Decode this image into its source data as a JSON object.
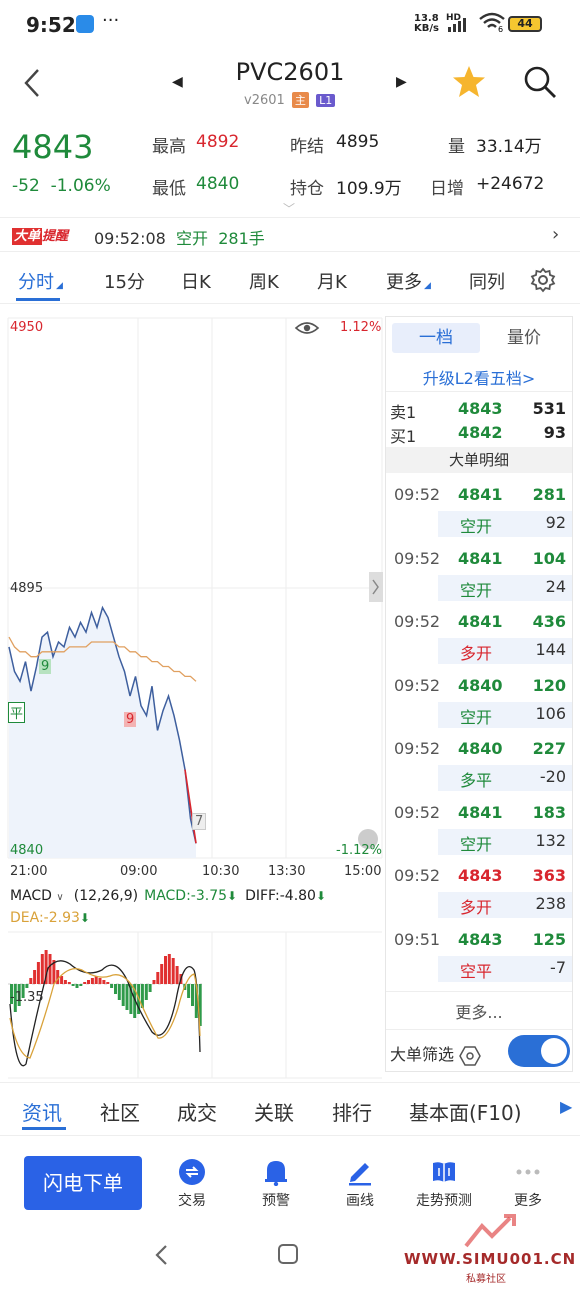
{
  "status": {
    "time": "9:52",
    "dots": "···",
    "net_top": "13.8",
    "net_bottom": "KB/s",
    "hd": "HD",
    "wifi_sub": "6",
    "battery": "44"
  },
  "title": {
    "symbol": "PVC2601",
    "contract": "v2601",
    "tag_main": "主",
    "tag_l1": "L1"
  },
  "quote": {
    "price": "4843",
    "change": "-52",
    "change_pct": "-1.06%",
    "high_label": "最高",
    "high": "4892",
    "low_label": "最低",
    "low": "4840",
    "prev_settle_label": "昨结",
    "prev_settle": "4895",
    "open_int_label": "持仓",
    "open_int": "109.9万",
    "volume_label": "量",
    "volume": "33.14万",
    "daily_inc_label": "日增",
    "daily_inc": "+24672"
  },
  "alert": {
    "badge1": "大单",
    "badge2": "提醒",
    "time": "09:52:08",
    "type": "空开",
    "qty": "281手"
  },
  "tabs": [
    "分时",
    "15分",
    "日K",
    "周K",
    "月K",
    "更多",
    "同列"
  ],
  "chart": {
    "y_top": "4950",
    "y_top_pct": "1.12%",
    "y_mid": "4895",
    "y_bot": "4840",
    "y_bot_pct": "-1.12%",
    "x_labels": [
      "21:00",
      "09:00",
      "10:30",
      "13:30",
      "15:00"
    ],
    "marker_flat": "平",
    "marker_9a": "9",
    "marker_9b": "9",
    "marker_7": "7",
    "macd_name": "MACD",
    "macd_params": "(12,26,9)",
    "macd_val": "MACD:-3.75",
    "diff_val": "DIFF:-4.80",
    "dea_val": "DEA:-2.93",
    "macd_axis": "-1.35"
  },
  "chart_data": {
    "type": "line",
    "series": [
      {
        "values": [
          4883,
          4878,
          4876,
          4880,
          4874,
          4879,
          4885,
          4886,
          4881,
          4884,
          4883,
          4887,
          4885,
          4888,
          4886,
          4890,
          4887,
          4891,
          4889,
          4885,
          4881,
          4878,
          4873,
          4877,
          4871,
          4869,
          4875,
          4866,
          4870,
          4873,
          4869,
          4864,
          4858,
          4848,
          4843
        ]
      },
      {
        "values": [
          4885,
          4883,
          4882,
          4882,
          4881,
          4881,
          4882,
          4882,
          4882,
          4882,
          4882,
          4883,
          4883,
          4883,
          4883,
          4884,
          4884,
          4884,
          4884,
          4884,
          4883,
          4883,
          4882,
          4882,
          4881,
          4881,
          4880,
          4880,
          4879,
          4879,
          4878,
          4878,
          4877,
          4877,
          4876
        ]
      }
    ],
    "ylim": [
      4840,
      4950
    ]
  },
  "book": {
    "seg1": "一档",
    "seg2": "量价",
    "l2": "升级L2看五档>",
    "ask_label": "卖1",
    "ask_price": "4843",
    "ask_vol": "531",
    "bid_label": "买1",
    "bid_price": "4842",
    "bid_vol": "93",
    "detail": "大单明细",
    "trades": [
      {
        "time": "09:52",
        "price": "4841",
        "vol": "281",
        "type": "空开",
        "oi": "92",
        "pc": "green",
        "tc": "green"
      },
      {
        "time": "09:52",
        "price": "4841",
        "vol": "104",
        "type": "空开",
        "oi": "24",
        "pc": "green",
        "tc": "green"
      },
      {
        "time": "09:52",
        "price": "4841",
        "vol": "436",
        "type": "多开",
        "oi": "144",
        "pc": "green",
        "tc": "red"
      },
      {
        "time": "09:52",
        "price": "4840",
        "vol": "120",
        "type": "空开",
        "oi": "106",
        "pc": "green",
        "tc": "green"
      },
      {
        "time": "09:52",
        "price": "4840",
        "vol": "227",
        "type": "多平",
        "oi": "-20",
        "pc": "green",
        "tc": "green"
      },
      {
        "time": "09:52",
        "price": "4841",
        "vol": "183",
        "type": "空开",
        "oi": "132",
        "pc": "green",
        "tc": "green"
      },
      {
        "time": "09:52",
        "price": "4843",
        "vol": "363",
        "type": "多开",
        "oi": "238",
        "pc": "red",
        "tc": "red"
      },
      {
        "time": "09:51",
        "price": "4843",
        "vol": "125",
        "type": "空平",
        "oi": "-7",
        "pc": "green",
        "tc": "red"
      }
    ],
    "more": "更多...",
    "filter": "大单筛选"
  },
  "info_tabs": [
    "资讯",
    "社区",
    "成交",
    "关联",
    "排行",
    "基本面(F10)"
  ],
  "toolbar": {
    "flash": "闪电下单",
    "items": [
      "交易",
      "预警",
      "画线",
      "走势预测",
      "更多"
    ]
  },
  "watermark": {
    "site": "WWW.SIMU001.CN",
    "sub": "私募社区"
  },
  "colors": {
    "green": "#1f8a3b",
    "red": "#d8262e",
    "accent": "#2a6fd6"
  }
}
